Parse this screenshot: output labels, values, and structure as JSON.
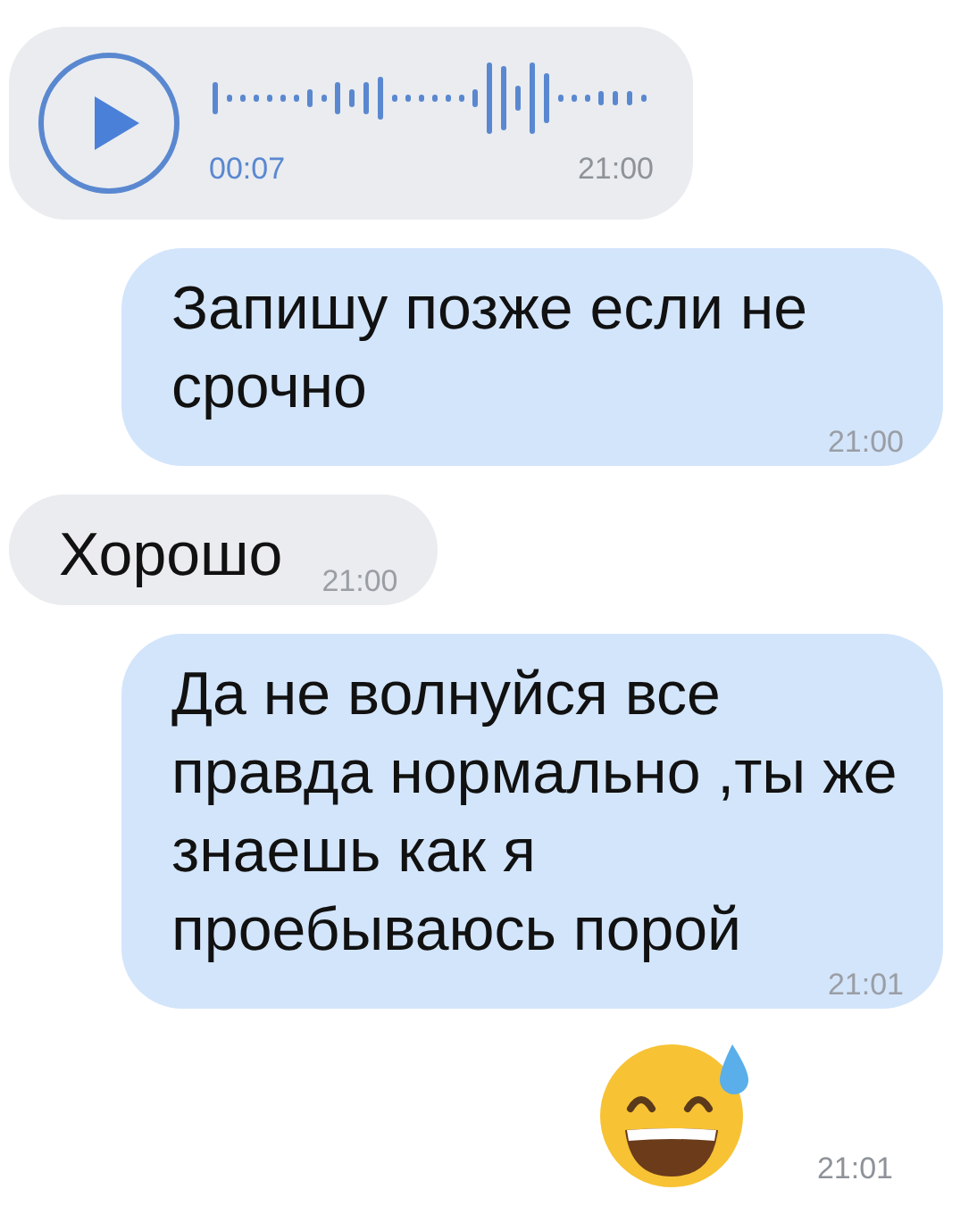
{
  "messages": [
    {
      "kind": "voice",
      "outgoing": false,
      "duration": "00:07",
      "time": "21:00"
    },
    {
      "kind": "text",
      "outgoing": true,
      "text": "Запишу позже если не срочно",
      "time": "21:00"
    },
    {
      "kind": "text",
      "outgoing": false,
      "text": "Хорошо",
      "time": "21:00"
    },
    {
      "kind": "text",
      "outgoing": true,
      "text": "Да не волнуйся все правда нормально ,ты же знаешь как я проебываюсь порой",
      "time": "21:01"
    },
    {
      "kind": "emoji",
      "outgoing": true,
      "time": "21:01"
    }
  ]
}
